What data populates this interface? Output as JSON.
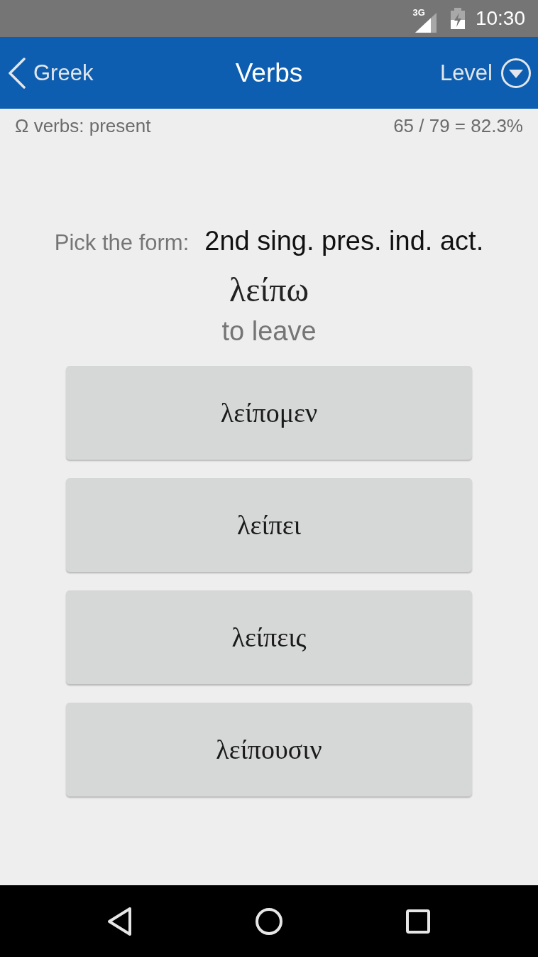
{
  "status_bar": {
    "network": "3G",
    "time": "10:30"
  },
  "app_bar": {
    "back_label": "Greek",
    "title": "Verbs",
    "menu_label": "Level"
  },
  "subheader": {
    "topic": "Ω verbs: present",
    "score": "65 / 79 = 82.3%"
  },
  "question": {
    "prompt": "Pick the form:",
    "form": "2nd sing. pres. ind. act.",
    "lemma": "λείπω",
    "meaning": "to leave"
  },
  "options": [
    {
      "label": "λείπομεν"
    },
    {
      "label": "λείπει"
    },
    {
      "label": "λείπεις"
    },
    {
      "label": "λείπουσιν"
    }
  ]
}
